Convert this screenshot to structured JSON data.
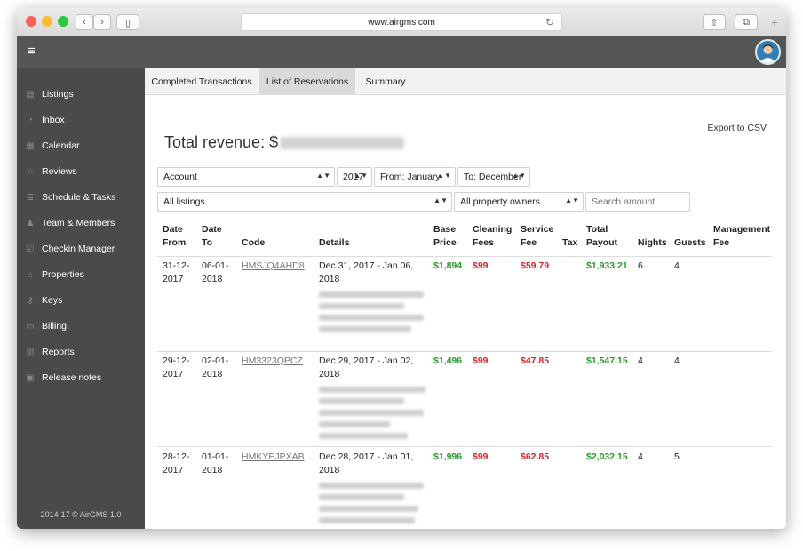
{
  "browser": {
    "url": "www.airgms.com"
  },
  "sidebar": {
    "items": [
      {
        "label": "Listings",
        "icon": "document-icon",
        "glyph": "▤"
      },
      {
        "label": "Inbox",
        "icon": "chat-icon",
        "glyph": "◔"
      },
      {
        "label": "Calendar",
        "icon": "calendar-icon",
        "glyph": "▦"
      },
      {
        "label": "Reviews",
        "icon": "star-icon",
        "glyph": "☆"
      },
      {
        "label": "Schedule & Tasks",
        "icon": "tasks-icon",
        "glyph": "≣"
      },
      {
        "label": "Team & Members",
        "icon": "team-icon",
        "glyph": "♟"
      },
      {
        "label": "Checkin Manager",
        "icon": "checkin-icon",
        "glyph": "☑"
      },
      {
        "label": "Properties",
        "icon": "properties-icon",
        "glyph": "⌂"
      },
      {
        "label": "Keys",
        "icon": "key-icon",
        "glyph": "⚷"
      },
      {
        "label": "Billing",
        "icon": "billing-icon",
        "glyph": "▭"
      },
      {
        "label": "Reports",
        "icon": "reports-icon",
        "glyph": "▥"
      },
      {
        "label": "Release notes",
        "icon": "release-notes-icon",
        "glyph": "▣"
      }
    ],
    "footer": "2014-17 © AirGMS 1.0"
  },
  "tabs": [
    {
      "label": "Completed Transactions",
      "active": false
    },
    {
      "label": "List of Reservations",
      "active": true
    },
    {
      "label": "Summary",
      "active": false
    }
  ],
  "export_label": "Export to CSV",
  "revenue_label": "Total revenue: $",
  "filters": {
    "account": "Account",
    "year": "2017",
    "from": "From: January",
    "to": "To: December",
    "listings": "All listings",
    "owners": "All property owners",
    "search_placeholder": "Search amount"
  },
  "columns": {
    "date_from": [
      "Date",
      "From"
    ],
    "date_to": [
      "Date",
      "To"
    ],
    "code": "Code",
    "details": "Details",
    "base_price": [
      "Base",
      "Price"
    ],
    "cleaning_fees": [
      "Cleaning",
      "Fees"
    ],
    "service_fee": [
      "Service",
      "Fee"
    ],
    "tax": "Tax",
    "total_payout": [
      "Total",
      "Payout"
    ],
    "nights": "Nights",
    "guests": "Guests",
    "management_fee": [
      "Management",
      "Fee"
    ]
  },
  "rows": [
    {
      "from": [
        "31-12-",
        "2017"
      ],
      "to": [
        "06-01-",
        "2018"
      ],
      "code": "HMSJQ4AHD8",
      "details": [
        "Dec 31, 2017 - Jan 06,",
        "2018"
      ],
      "base": "$1,894",
      "cleaning": "$99",
      "service": "$59.79",
      "tax": "",
      "total": "$1,933.21",
      "nights": "6",
      "guests": "4",
      "mgmt": ""
    },
    {
      "from": [
        "29-12-",
        "2017"
      ],
      "to": [
        "02-01-",
        "2018"
      ],
      "code": "HM3323QPCZ",
      "details": [
        "Dec 29, 2017 - Jan 02,",
        "2018"
      ],
      "base": "$1,496",
      "cleaning": "$99",
      "service": "$47.85",
      "tax": "",
      "total": "$1,547.15",
      "nights": "4",
      "guests": "4",
      "mgmt": ""
    },
    {
      "from": [
        "28-12-",
        "2017"
      ],
      "to": [
        "01-01-",
        "2018"
      ],
      "code": "HMKYEJPXAB",
      "details": [
        "Dec 28, 2017 - Jan 01,",
        "2018"
      ],
      "base": "$1,996",
      "cleaning": "$99",
      "service": "$62.85",
      "tax": "",
      "total": "$2,032.15",
      "nights": "4",
      "guests": "5",
      "mgmt": ""
    }
  ],
  "colors": {
    "sidebar": "#4a4a4a",
    "appbar": "#555555",
    "positive": "#2e9a2e",
    "negative": "#d9262c"
  }
}
